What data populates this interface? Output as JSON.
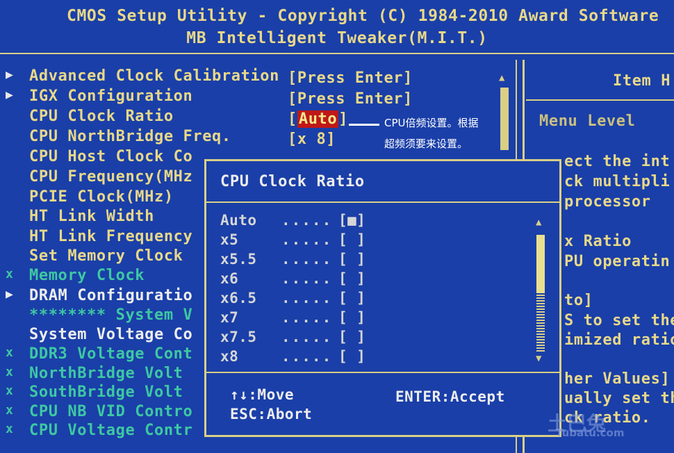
{
  "header": {
    "line1": "CMOS Setup Utility - Copyright (C) 1984-2010 Award Software",
    "line2": "MB Intelligent Tweaker(M.I.T.)"
  },
  "menu": {
    "items": [
      {
        "marker": "▶",
        "label": "Advanced Clock Calibration",
        "style": "normal"
      },
      {
        "marker": "▶",
        "label": "IGX Configuration",
        "style": "normal"
      },
      {
        "marker": "",
        "label": "CPU Clock Ratio",
        "style": "normal"
      },
      {
        "marker": "",
        "label": "CPU NorthBridge Freq.",
        "style": "normal"
      },
      {
        "marker": "",
        "label": "CPU Host Clock Co",
        "style": "normal"
      },
      {
        "marker": "",
        "label": "CPU Frequency(MHz",
        "style": "normal"
      },
      {
        "marker": "",
        "label": "PCIE Clock(MHz)",
        "style": "normal"
      },
      {
        "marker": "",
        "label": "HT Link Width",
        "style": "normal"
      },
      {
        "marker": "",
        "label": "HT Link Frequency",
        "style": "normal"
      },
      {
        "marker": "",
        "label": "Set Memory Clock",
        "style": "normal"
      },
      {
        "marker": "x",
        "label": "Memory Clock",
        "style": "disabled"
      },
      {
        "marker": "▶",
        "label": "DRAM Configuratio",
        "style": "white"
      },
      {
        "marker": "",
        "label": "******** System V",
        "style": "disabled"
      },
      {
        "marker": "",
        "label": "System Voltage Co",
        "style": "white"
      },
      {
        "marker": "x",
        "label": "DDR3 Voltage Cont",
        "style": "disabled"
      },
      {
        "marker": "x",
        "label": "NorthBridge Volt",
        "style": "disabled"
      },
      {
        "marker": "x",
        "label": "SouthBridge Volt",
        "style": "disabled"
      },
      {
        "marker": "x",
        "label": "CPU NB VID Contro",
        "style": "disabled"
      },
      {
        "marker": "x",
        "label": "CPU Voltage Contr",
        "style": "disabled"
      }
    ],
    "values": {
      "advanced_clock": "[Press Enter]",
      "igx": "[Press Enter]",
      "cpu_clock_ratio_open": "[",
      "cpu_clock_ratio_value": "Auto",
      "cpu_clock_ratio_close": "]",
      "northbridge_freq": "[x 8]"
    }
  },
  "annotation": {
    "line1": "CPU倍频设置。根据",
    "line2": "超频须要来设置。"
  },
  "help": {
    "title": "Item H",
    "menu_level": "Menu Level",
    "lines": [
      "ect the int",
      "ck multipli",
      " processor",
      "",
      " x Ratio",
      "PU operatin",
      "",
      "to]",
      "S to set the",
      "imized ratio",
      "",
      "her Values]",
      "ually set the",
      "ck ratio."
    ]
  },
  "popup": {
    "title": "CPU Clock Ratio",
    "options": [
      {
        "label": "Auto",
        "dots": ".....",
        "box": "[■]"
      },
      {
        "label": "x5",
        "dots": ".....",
        "box": "[ ]"
      },
      {
        "label": "x5.5",
        "dots": ".....",
        "box": "[ ]"
      },
      {
        "label": "x6",
        "dots": ".....",
        "box": "[ ]"
      },
      {
        "label": "x6.5",
        "dots": ".....",
        "box": "[ ]"
      },
      {
        "label": "x7",
        "dots": ".....",
        "box": "[ ]"
      },
      {
        "label": "x7.5",
        "dots": ".....",
        "box": "[ ]"
      },
      {
        "label": "x8",
        "dots": ".....",
        "box": "[ ]"
      }
    ],
    "footer": {
      "move": "↑↓:Move",
      "accept": "ENTER:Accept",
      "abort": "ESC:Abort"
    }
  },
  "watermark": {
    "main": "土巴兔",
    "sub": "Tubatu.com"
  }
}
